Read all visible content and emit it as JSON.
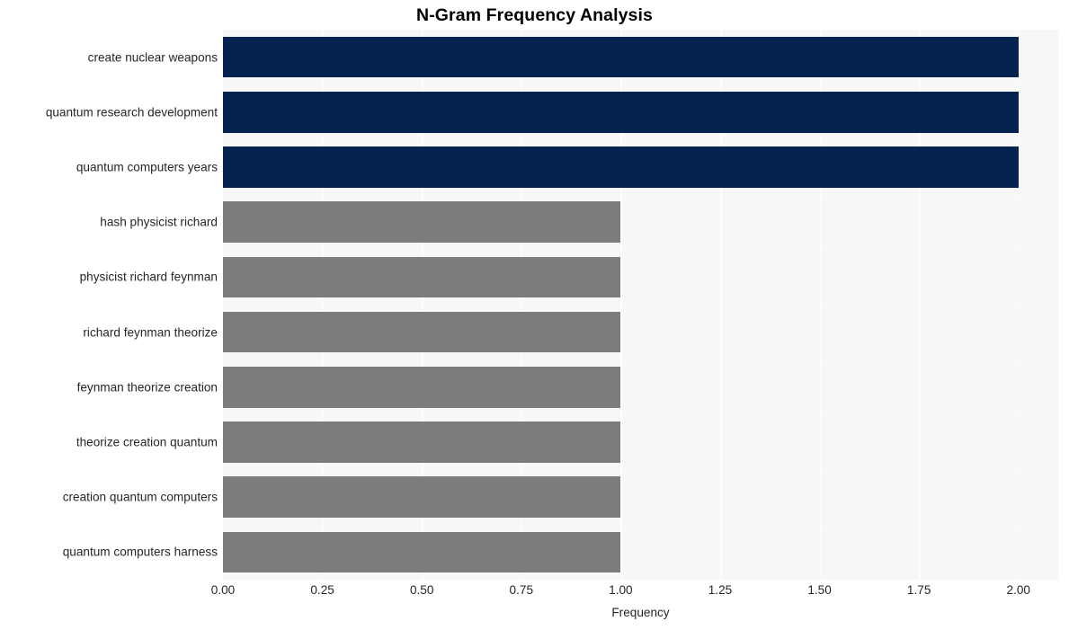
{
  "chart_data": {
    "type": "bar",
    "orientation": "horizontal",
    "title": "N-Gram Frequency Analysis",
    "xlabel": "Frequency",
    "ylabel": "",
    "xlim": [
      0.0,
      2.1
    ],
    "xticks": [
      "0.00",
      "0.25",
      "0.50",
      "0.75",
      "1.00",
      "1.25",
      "1.50",
      "1.75",
      "2.00"
    ],
    "xtick_values": [
      0.0,
      0.25,
      0.5,
      0.75,
      1.0,
      1.25,
      1.5,
      1.75,
      2.0
    ],
    "grid": true,
    "legend": null,
    "categories": [
      "create nuclear weapons",
      "quantum research development",
      "quantum computers years",
      "hash physicist richard",
      "physicist richard feynman",
      "richard feynman theorize",
      "feynman theorize creation",
      "theorize creation quantum",
      "creation quantum computers",
      "quantum computers harness"
    ],
    "values": [
      2,
      2,
      2,
      1,
      1,
      1,
      1,
      1,
      1,
      1
    ],
    "bar_colors": [
      "#04244f",
      "#04244f",
      "#04244f",
      "#7c7c7a",
      "#7c7c7a",
      "#7c7c7a",
      "#7c7c7a",
      "#7c7c7a",
      "#7c7c7a",
      "#7c7c7a"
    ]
  },
  "style": {
    "plot_background": "#f7f7f8",
    "page_background": "#ffffff",
    "gridline_color": "#fdfdfe",
    "text_color": "#262626",
    "title_color": "#000000",
    "highlight_color": "#04244f",
    "base_color": "#7c7c7a"
  }
}
